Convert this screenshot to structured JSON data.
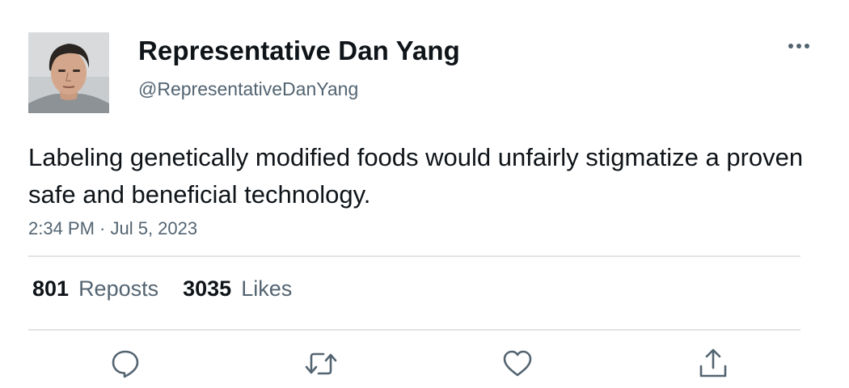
{
  "tweet": {
    "author": {
      "display_name": "Representative Dan Yang",
      "handle": "@RepresentativeDanYang",
      "avatar": "profile-photo"
    },
    "text": "Labeling genetically modified foods would unfairly stigmatize a proven safe and beneficial technology.",
    "timestamp": "2:34 PM · Jul 5, 2023",
    "stats": {
      "reposts_count": "801",
      "reposts_label": "Reposts",
      "likes_count": "3035",
      "likes_label": "Likes"
    },
    "actions": {
      "reply_icon": "reply-icon",
      "repost_icon": "repost-icon",
      "like_icon": "like-icon",
      "share_icon": "share-icon",
      "more_icon": "more-icon"
    }
  },
  "colors": {
    "text_primary": "#0f1419",
    "text_secondary": "#536471",
    "divider": "#e1e4e7",
    "icon": "#536471"
  }
}
